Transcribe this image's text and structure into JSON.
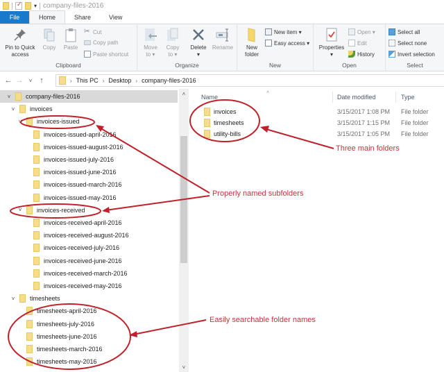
{
  "window": {
    "title": "company-files-2016"
  },
  "tabs": [
    {
      "label": "File"
    },
    {
      "label": "Home"
    },
    {
      "label": "Share"
    },
    {
      "label": "View"
    }
  ],
  "ribbon": {
    "clipboard": {
      "label": "Clipboard",
      "pin": "Pin to Quick access",
      "pin_line1": "Pin to Quick",
      "pin_line2": "access",
      "copy": "Copy",
      "paste": "Paste",
      "cut": "Cut",
      "copy_path": "Copy path",
      "paste_shortcut": "Paste shortcut"
    },
    "organize": {
      "label": "Organize",
      "move_to_1": "Move",
      "move_to_2": "to ▾",
      "copy_to_1": "Copy",
      "copy_to_2": "to ▾",
      "delete": "Delete",
      "rename": "Rename"
    },
    "new": {
      "label": "New",
      "new_folder_1": "New",
      "new_folder_2": "folder",
      "new_item": "New item ▾",
      "easy_access": "Easy access ▾"
    },
    "open": {
      "label": "Open",
      "properties": "Properties",
      "open": "Open ▾",
      "edit": "Edit",
      "history": "History"
    },
    "select": {
      "label": "Select",
      "select_all": "Select all",
      "select_none": "Select none",
      "invert": "Invert selection"
    }
  },
  "address": {
    "crumbs": [
      "This PC",
      "Desktop",
      "company-files-2016"
    ]
  },
  "tree": [
    {
      "label": "company-files-2016",
      "level": 0,
      "expanded": true,
      "selected": true
    },
    {
      "label": "invoices",
      "level": 1,
      "expanded": true
    },
    {
      "label": "invoices-issued",
      "level": 2,
      "expanded": true
    },
    {
      "label": "invoices-issued-april-2016",
      "level": 3
    },
    {
      "label": "invoices-issued-august-2016",
      "level": 3
    },
    {
      "label": "invoices-issued-july-2016",
      "level": 3
    },
    {
      "label": "invoices-issued-june-2016",
      "level": 3
    },
    {
      "label": "invoices-issued-march-2016",
      "level": 3
    },
    {
      "label": "invoices-issued-may-2016",
      "level": 3
    },
    {
      "label": "invoices-received",
      "level": 2,
      "expanded": true
    },
    {
      "label": "invoices-received-april-2016",
      "level": 3
    },
    {
      "label": "invoices-received-august-2016",
      "level": 3
    },
    {
      "label": "invoices-received-july-2016",
      "level": 3
    },
    {
      "label": "invoices-received-june-2016",
      "level": 3
    },
    {
      "label": "invoices-received-march-2016",
      "level": 3
    },
    {
      "label": "invoices-received-may-2016",
      "level": 3
    },
    {
      "label": "timesheets",
      "level": 1,
      "expanded": true
    },
    {
      "label": "timesheets-april-2016",
      "level": 2
    },
    {
      "label": "timesheets-july-2016",
      "level": 2
    },
    {
      "label": "timesheets-june-2016",
      "level": 2
    },
    {
      "label": "timesheets-march-2016",
      "level": 2
    },
    {
      "label": "timesheets-may-2016",
      "level": 2
    }
  ],
  "columns": {
    "name": "Name",
    "date": "Date modified",
    "type": "Type"
  },
  "files": [
    {
      "name": "invoices",
      "date": "3/15/2017 1:08 PM",
      "type": "File folder"
    },
    {
      "name": "timesheets",
      "date": "3/15/2017 1:15 PM",
      "type": "File folder"
    },
    {
      "name": "utility-bills",
      "date": "3/15/2017 1:05 PM",
      "type": "File folder"
    }
  ],
  "annotations": {
    "main_folders": "Three main folders",
    "subfolders": "Properly named subfolders",
    "searchable": "Easily searchable folder names",
    "color": "#c0353d"
  }
}
